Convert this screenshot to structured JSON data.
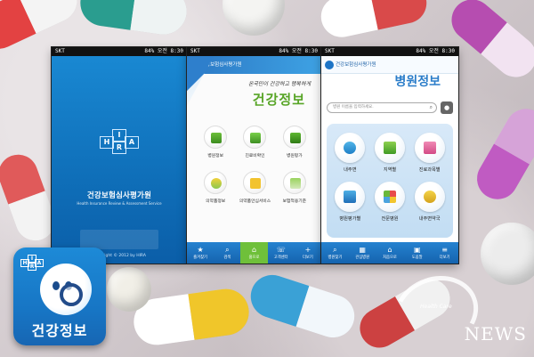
{
  "status_bar": {
    "carrier": "SKT",
    "battery": "84%",
    "time": "오전 8:30"
  },
  "splash": {
    "app_name": "건강보험심사평가원",
    "subtitle": "Health Insurance Review & Assessment Service",
    "logo_letters": [
      "H",
      "I",
      "R",
      "A"
    ],
    "copyright": "Copyright © 2012 by HIRA"
  },
  "main_menu": {
    "header": "건강보험심사평가원",
    "slogan": "온국민이 건강하고 행복하게",
    "title": "건강정보",
    "items": [
      {
        "label": "병원정보",
        "icon": "hospital-building-icon"
      },
      {
        "label": "진료비확인",
        "icon": "receipt-check-icon"
      },
      {
        "label": "병원평가",
        "icon": "bar-chart-icon"
      },
      {
        "label": "의약품정보",
        "icon": "pills-icon"
      },
      {
        "label": "의약품안심서비스",
        "icon": "dur-icon"
      },
      {
        "label": "보험적용기준",
        "icon": "insurance-doc-icon"
      }
    ],
    "pager": {
      "prev": "‹",
      "next": "›"
    },
    "tabs": [
      {
        "label": "즐겨찾기",
        "icon": "★"
      },
      {
        "label": "검색",
        "icon": "⌕"
      },
      {
        "label": "홈으로",
        "icon": "⌂"
      },
      {
        "label": "고객센터",
        "icon": "☏"
      },
      {
        "label": "더보기",
        "icon": "+"
      }
    ]
  },
  "hospital": {
    "header": "건강보험심사평가원",
    "title": "병원정보",
    "search_placeholder": "병원 이름을 입력하세요.",
    "items": [
      {
        "label": "내주변",
        "icon": "location-signal-icon"
      },
      {
        "label": "지역별",
        "icon": "map-region-icon"
      },
      {
        "label": "진료과목별",
        "icon": "medical-dept-icon"
      },
      {
        "label": "병원평가별",
        "icon": "rating-chart-icon"
      },
      {
        "label": "전문병원",
        "icon": "specialty-cross-icon"
      },
      {
        "label": "내주변약국",
        "icon": "pharmacy-icon"
      }
    ],
    "pager": {
      "prev": "‹",
      "next": "›"
    },
    "tabs": [
      {
        "label": "병원찾기",
        "icon": "⌕"
      },
      {
        "label": "관심병원",
        "icon": "▦"
      },
      {
        "label": "처음으로",
        "icon": "⌂"
      },
      {
        "label": "도움말",
        "icon": "▣"
      },
      {
        "label": "더보기",
        "icon": "≡"
      }
    ]
  },
  "app_icon": {
    "label": "건강정보",
    "logo_letters": [
      "H",
      "I",
      "R",
      "A"
    ]
  },
  "watermark": {
    "tagline": "Health Care",
    "brand": "NEWS"
  },
  "colors": {
    "brand_blue": "#1a8ad4",
    "accent_green": "#58a527",
    "active_tab": "#6fc03a",
    "page_dot_orange": "#f29a2e"
  }
}
